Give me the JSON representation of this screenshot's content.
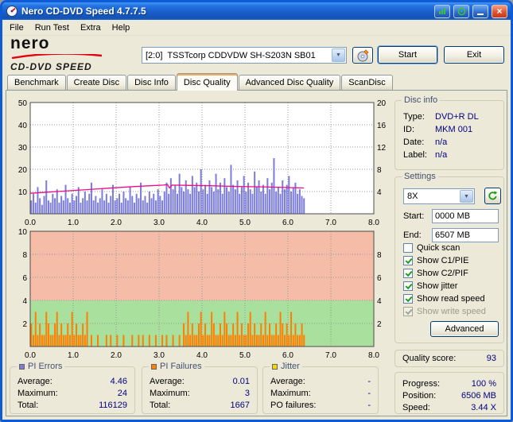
{
  "window": {
    "title": "Nero CD-DVD Speed 4.7.7.5"
  },
  "menu": {
    "items": [
      "File",
      "Run Test",
      "Extra",
      "Help"
    ]
  },
  "logo": {
    "brand": "nero",
    "product": "CD-DVD SPEED"
  },
  "toolbar": {
    "drive": "[2:0]  TSSTcorp CDDVDW SH-S203N SB01",
    "start_label": "Start",
    "exit_label": "Exit"
  },
  "tabs": {
    "items": [
      "Benchmark",
      "Create Disc",
      "Disc Info",
      "Disc Quality",
      "Advanced Disc Quality",
      "ScanDisc"
    ],
    "active": "Disc Quality"
  },
  "disc_info": {
    "title": "Disc info",
    "rows": [
      [
        "Type:",
        "DVD+R DL"
      ],
      [
        "ID:",
        "MKM 001"
      ],
      [
        "Date:",
        "n/a"
      ],
      [
        "Label:",
        "n/a"
      ]
    ]
  },
  "settings": {
    "title": "Settings",
    "speed_value": "8X",
    "start_label": "Start:",
    "start_value": "0000 MB",
    "end_label": "End:",
    "end_value": "6507 MB",
    "checkboxes": [
      {
        "label": "Quick scan",
        "checked": false,
        "disabled": false
      },
      {
        "label": "Show C1/PIE",
        "checked": true,
        "disabled": false
      },
      {
        "label": "Show C2/PIF",
        "checked": true,
        "disabled": false
      },
      {
        "label": "Show jitter",
        "checked": true,
        "disabled": false
      },
      {
        "label": "Show read speed",
        "checked": true,
        "disabled": false
      },
      {
        "label": "Show write speed",
        "checked": true,
        "disabled": true
      }
    ],
    "advanced_label": "Advanced"
  },
  "quality": {
    "label": "Quality score:",
    "value": "93"
  },
  "stats": {
    "pi_errors": {
      "title": "PI Errors",
      "legend_color": "#7d7dd4",
      "rows": [
        [
          "Average:",
          "4.46"
        ],
        [
          "Maximum:",
          "24"
        ],
        [
          "Total:",
          "116129"
        ]
      ]
    },
    "pi_failures": {
      "title": "PI Failures",
      "legend_color": "#ff8000",
      "rows": [
        [
          "Average:",
          "0.01"
        ],
        [
          "Maximum:",
          "3"
        ],
        [
          "Total:",
          "1667"
        ]
      ]
    },
    "jitter": {
      "title": "Jitter",
      "legend_color": "#f2d800",
      "rows": [
        [
          "Average:",
          "-"
        ],
        [
          "Maximum:",
          "-"
        ],
        [
          "PO failures:",
          "-"
        ]
      ]
    }
  },
  "status": {
    "rows": [
      [
        "Progress:",
        "100 %"
      ],
      [
        "Position:",
        "6506 MB"
      ],
      [
        "Speed:",
        "3.44 X"
      ]
    ]
  },
  "chart_data": [
    {
      "type": "bar",
      "name": "pi-errors-scan",
      "series": [
        {
          "name": "PI Errors (PIE)",
          "type": "bar",
          "color": "#7c7cda"
        },
        {
          "name": "Read speed",
          "type": "line",
          "color": "#ef0b8d"
        }
      ],
      "x_range": [
        0,
        8
      ],
      "x_ticks": [
        "0.0",
        "1.0",
        "2.0",
        "3.0",
        "4.0",
        "5.0",
        "6.0",
        "7.0",
        "8.0"
      ],
      "y_left_range": [
        0,
        50
      ],
      "y_left_ticks": [
        50,
        40,
        30,
        20,
        10
      ],
      "y_right_range": [
        0,
        20
      ],
      "y_right_ticks": [
        20,
        16,
        12,
        8,
        4
      ],
      "grid_y": [
        10,
        20,
        30,
        40
      ],
      "plot_bg": "#ffffff",
      "bar_color": "#7c7cda",
      "line_color": "#ef0b8d",
      "bar_x_start": 0.025,
      "bar_x_step": 0.05,
      "bar_values": [
        6,
        9,
        5,
        12,
        7,
        4,
        8,
        15,
        6,
        5,
        9,
        7,
        11,
        5,
        8,
        6,
        13,
        7,
        5,
        9,
        6,
        8,
        12,
        5,
        7,
        10,
        6,
        9,
        14,
        6,
        8,
        5,
        7,
        11,
        6,
        9,
        5,
        8,
        13,
        6,
        7,
        9,
        5,
        10,
        7,
        6,
        12,
        8,
        5,
        9,
        7,
        14,
        6,
        8,
        5,
        10,
        7,
        9,
        6,
        11,
        8,
        6,
        10,
        14,
        9,
        16,
        11,
        13,
        9,
        18,
        12,
        10,
        15,
        11,
        9,
        17,
        12,
        14,
        10,
        20,
        11,
        13,
        9,
        15,
        12,
        10,
        18,
        11,
        14,
        9,
        16,
        12,
        10,
        22,
        13,
        11,
        15,
        9,
        12,
        17,
        10,
        14,
        11,
        9,
        19,
        12,
        15,
        10,
        13,
        9,
        16,
        11,
        14,
        25,
        10,
        12,
        9,
        15,
        11,
        13,
        17,
        10,
        12,
        14,
        9,
        11,
        8,
        7
      ],
      "line_points": [
        [
          0,
          9.2
        ],
        [
          0.4,
          9.7
        ],
        [
          0.8,
          10.2
        ],
        [
          1.2,
          10.7
        ],
        [
          1.6,
          11.2
        ],
        [
          2,
          11.7
        ],
        [
          2.4,
          12.2
        ],
        [
          2.8,
          12.6
        ],
        [
          3.1,
          12.9
        ],
        [
          3.2,
          13.1
        ],
        [
          3.24,
          11.6
        ],
        [
          3.3,
          12.9
        ],
        [
          3.6,
          12.8
        ],
        [
          4.2,
          12.6
        ],
        [
          4.8,
          12.3
        ],
        [
          5.4,
          12.1
        ],
        [
          6,
          11.8
        ],
        [
          6.37,
          11.6
        ]
      ]
    },
    {
      "type": "bar",
      "name": "pi-failures-scan",
      "series": [
        {
          "name": "PI Failures (PIF)",
          "type": "bar",
          "color": "#ff7f00"
        }
      ],
      "x_range": [
        0,
        8
      ],
      "x_ticks": [
        "0.0",
        "1.0",
        "2.0",
        "3.0",
        "4.0",
        "5.0",
        "6.0",
        "7.0",
        "8.0"
      ],
      "y_range": [
        0,
        10
      ],
      "y_left_ticks": [
        10,
        8,
        6,
        4,
        2
      ],
      "y_right_ticks": [
        8,
        6,
        4,
        2
      ],
      "grid_y": [
        2,
        4,
        6,
        8
      ],
      "zones": [
        {
          "from": 0,
          "to": 4,
          "color": "#a9e09e"
        },
        {
          "from": 4,
          "to": 10,
          "color": "#f5bda8"
        }
      ],
      "bar_color": "#ff7f00",
      "bar_x_start": 0.025,
      "bar_x_step": 0.05,
      "bar_values": [
        2,
        1,
        3,
        1,
        2,
        1,
        1,
        3,
        2,
        1,
        1,
        2,
        3,
        1,
        2,
        1,
        1,
        2,
        1,
        3,
        1,
        2,
        1,
        1,
        2,
        1,
        3,
        0,
        1,
        0,
        0,
        1,
        0,
        0,
        0,
        1,
        0,
        1,
        0,
        0,
        1,
        0,
        0,
        1,
        0,
        0,
        0,
        1,
        0,
        0,
        1,
        0,
        1,
        0,
        0,
        1,
        0,
        0,
        1,
        0,
        0,
        1,
        0,
        1,
        0,
        0,
        1,
        0,
        0,
        1,
        0,
        2,
        1,
        3,
        1,
        2,
        1,
        1,
        2,
        3,
        1,
        2,
        1,
        1,
        3,
        2,
        1,
        1,
        2,
        1,
        3,
        2,
        1,
        1,
        2,
        1,
        3,
        1,
        2,
        1,
        1,
        2,
        3,
        1,
        2,
        1,
        1,
        2,
        1,
        3,
        1,
        2,
        1,
        1,
        2,
        1,
        3,
        2,
        1,
        2,
        1,
        3,
        1,
        2,
        1,
        1,
        2,
        1
      ]
    }
  ]
}
